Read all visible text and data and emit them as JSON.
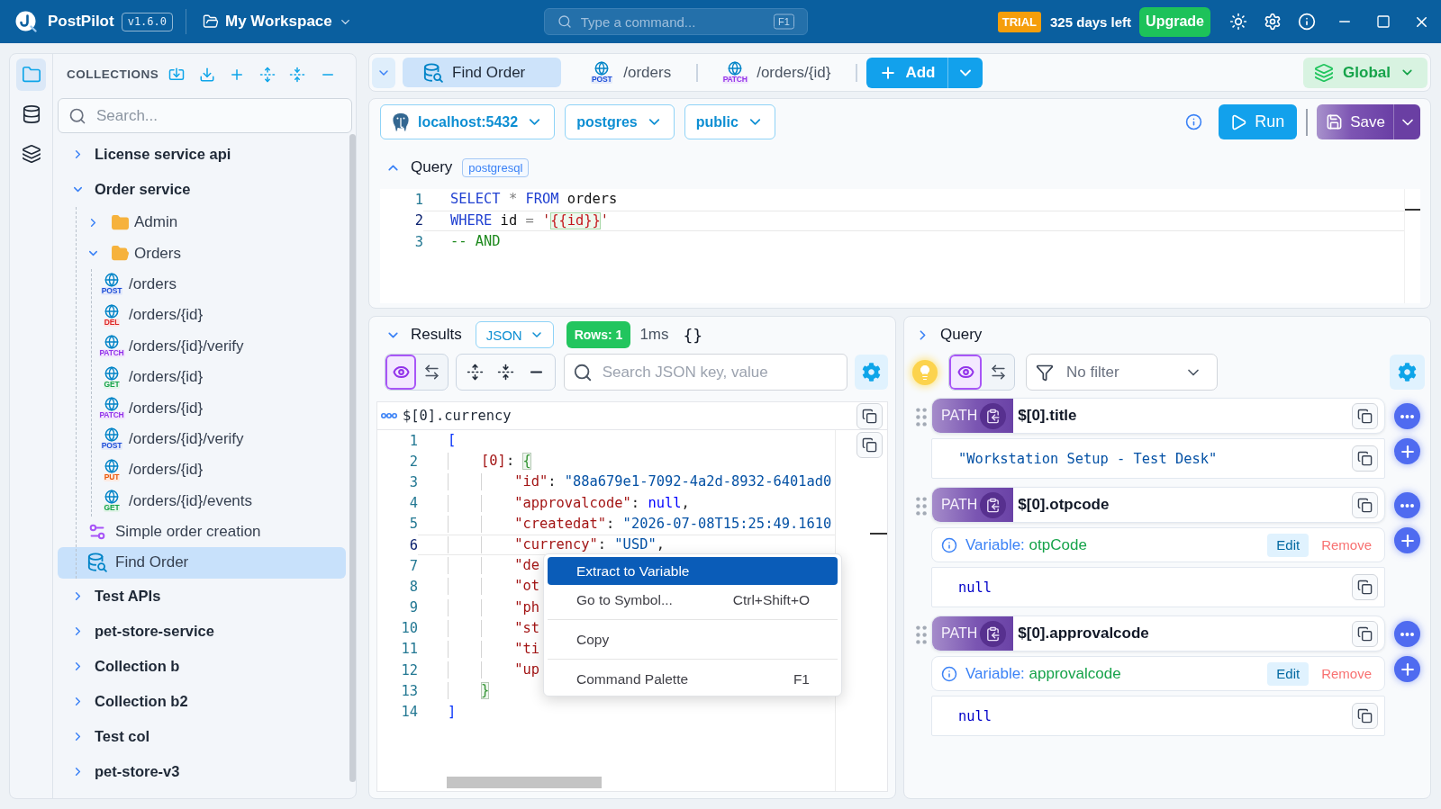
{
  "title_bar": {
    "app_name": "PostPilot",
    "version": "v1.6.0",
    "workspace": "My Workspace",
    "command": {
      "placeholder": "Type a command...",
      "shortcut": "F1"
    },
    "license": {
      "badge": "TRIAL",
      "remaining": "325 days left"
    },
    "upgrade": "Upgrade"
  },
  "activity_bar": [
    {
      "kind": "collections",
      "selected": true
    },
    {
      "kind": "databases",
      "selected": false
    },
    {
      "kind": "environments",
      "selected": false
    }
  ],
  "sidebar": {
    "title": "COLLECTIONS",
    "search": {
      "placeholder": "Search..."
    },
    "tree": [
      {
        "label": "License service api",
        "kind": "collection",
        "expanded": false,
        "selected": false
      },
      {
        "label": "Order service",
        "kind": "collection",
        "expanded": true,
        "selected": false,
        "children": [
          {
            "label": "Admin",
            "kind": "folder",
            "expanded": false,
            "selected": false
          },
          {
            "label": "Orders",
            "kind": "folder",
            "expanded": true,
            "selected": false,
            "children": [
              {
                "label": "/orders",
                "kind": "request",
                "method": "POST",
                "color": "#1d4ed8",
                "selected": false
              },
              {
                "label": "/orders/{id}",
                "kind": "request",
                "method": "DEL",
                "color": "#dc2626",
                "selected": false
              },
              {
                "label": "/orders/{id}/verify",
                "kind": "request",
                "method": "PATCH",
                "color": "#9333ea",
                "selected": false
              },
              {
                "label": "/orders/{id}",
                "kind": "request",
                "method": "GET",
                "color": "#16a34a",
                "selected": false
              },
              {
                "label": "/orders/{id}",
                "kind": "request",
                "method": "PATCH",
                "color": "#9333ea",
                "selected": false
              },
              {
                "label": "/orders/{id}/verify",
                "kind": "request",
                "method": "POST",
                "color": "#1d4ed8",
                "selected": false
              },
              {
                "label": "/orders/{id}",
                "kind": "request",
                "method": "PUT",
                "color": "#ea580c",
                "selected": false
              },
              {
                "label": "/orders/{id}/events",
                "kind": "request",
                "method": "GET",
                "color": "#16a34a",
                "selected": false
              }
            ]
          },
          {
            "label": "Simple order creation",
            "kind": "flow",
            "selected": false
          },
          {
            "label": "Find Order",
            "kind": "query",
            "selected": true
          }
        ]
      },
      {
        "label": "Test APIs",
        "kind": "collection",
        "expanded": false,
        "selected": false
      },
      {
        "label": "pet-store-service",
        "kind": "collection",
        "expanded": false,
        "selected": false
      },
      {
        "label": "Collection b",
        "kind": "collection",
        "expanded": false,
        "selected": false
      },
      {
        "label": "Collection b2",
        "kind": "collection",
        "expanded": false,
        "selected": false
      },
      {
        "label": "Test col",
        "kind": "collection",
        "expanded": false,
        "selected": false
      },
      {
        "label": "pet-store-v3",
        "kind": "collection",
        "expanded": false,
        "selected": false
      }
    ]
  },
  "tabs": {
    "items": [
      {
        "label": "Find Order",
        "kind": "query",
        "selected": true
      },
      {
        "label": "/orders",
        "kind": "request",
        "method": "POST",
        "color": "#1d4ed8",
        "selected": false
      },
      {
        "label": "/orders/{id}",
        "kind": "request",
        "method": "PATCH",
        "color": "#9333ea",
        "selected": false
      }
    ],
    "add": "Add",
    "environment": "Global"
  },
  "connection": {
    "selectors": [
      {
        "kind": "host",
        "label": "localhost:5432"
      },
      {
        "kind": "database",
        "label": "postgres"
      },
      {
        "kind": "schema",
        "label": "public"
      }
    ],
    "run": "Run",
    "save": "Save"
  },
  "query": {
    "title": "Query",
    "language": "postgresql",
    "lines": [
      {
        "number": "1",
        "active": false,
        "tokens": [
          {
            "text": "SELECT",
            "kind": "keyword"
          },
          {
            "text": " * ",
            "kind": "operator"
          },
          {
            "text": "FROM",
            "kind": "keyword"
          },
          {
            "text": " orders",
            "kind": "plain"
          }
        ]
      },
      {
        "number": "2",
        "active": true,
        "tokens": [
          {
            "text": "WHERE",
            "kind": "keyword"
          },
          {
            "text": " id ",
            "kind": "plain"
          },
          {
            "text": "= ",
            "kind": "operator"
          },
          {
            "text": "'",
            "kind": "quote"
          },
          {
            "text": "{{id}}",
            "kind": "variable"
          },
          {
            "text": "'",
            "kind": "quote"
          }
        ]
      },
      {
        "number": "3",
        "active": false,
        "tokens": [
          {
            "text": "-- AND",
            "kind": "comment"
          }
        ]
      }
    ]
  },
  "results": {
    "title": "Results",
    "format": "JSON",
    "rows": "Rows: 1",
    "duration": "1ms",
    "braces": "{}",
    "view_modes": [
      {
        "kind": "eye",
        "selected": true
      },
      {
        "kind": "swap",
        "selected": false
      }
    ],
    "search": {
      "placeholder": "Search JSON key, value"
    },
    "path": "$[0].currency",
    "lines": [
      {
        "number": "1",
        "active": false,
        "tokens": [
          {
            "text": "[",
            "kind": "open",
            "matched": false
          }
        ]
      },
      {
        "number": "2",
        "active": false,
        "tokens": [
          {
            "text": "[0]",
            "kind": "key"
          },
          {
            "text": ": ",
            "kind": "punct"
          },
          {
            "text": "{",
            "kind": "open",
            "matched": true
          }
        ]
      },
      {
        "number": "3",
        "active": false,
        "tokens": [
          {
            "text": "\"id\"",
            "kind": "key"
          },
          {
            "text": ": ",
            "kind": "punct"
          },
          {
            "text": "\"88a679e1-7092-4a2d-8932-6401ad0",
            "kind": "string"
          }
        ]
      },
      {
        "number": "4",
        "active": false,
        "tokens": [
          {
            "text": "\"approvalcode\"",
            "kind": "key"
          },
          {
            "text": ": ",
            "kind": "punct"
          },
          {
            "text": "null",
            "kind": "null"
          },
          {
            "text": ",",
            "kind": "punct"
          }
        ]
      },
      {
        "number": "5",
        "active": false,
        "tokens": [
          {
            "text": "\"createdat\"",
            "kind": "key"
          },
          {
            "text": ": ",
            "kind": "punct"
          },
          {
            "text": "\"2026-07-08T15:25:49.1610",
            "kind": "string"
          }
        ]
      },
      {
        "number": "6",
        "active": true,
        "tokens": [
          {
            "text": "\"currency\"",
            "kind": "key"
          },
          {
            "text": ": ",
            "kind": "punct"
          },
          {
            "text": "\"USD\"",
            "kind": "string"
          },
          {
            "text": ",",
            "kind": "punct"
          }
        ]
      },
      {
        "number": "7",
        "active": false,
        "tokens": [
          {
            "text": "\"de",
            "kind": "key"
          }
        ]
      },
      {
        "number": "8",
        "active": false,
        "tokens": [
          {
            "text": "\"ot",
            "kind": "key"
          }
        ]
      },
      {
        "number": "9",
        "active": false,
        "tokens": [
          {
            "text": "\"ph",
            "kind": "key"
          }
        ]
      },
      {
        "number": "10",
        "active": false,
        "tokens": [
          {
            "text": "\"st",
            "kind": "key"
          }
        ]
      },
      {
        "number": "11",
        "active": false,
        "tokens": [
          {
            "text": "\"ti",
            "kind": "key"
          }
        ]
      },
      {
        "number": "12",
        "active": false,
        "tokens": [
          {
            "text": "\"up",
            "kind": "key"
          }
        ]
      },
      {
        "number": "13",
        "active": false,
        "tokens": [
          {
            "text": "}",
            "kind": "close",
            "matched": true
          }
        ]
      },
      {
        "number": "14",
        "active": false,
        "tokens": [
          {
            "text": "]",
            "kind": "close",
            "matched": false
          }
        ]
      }
    ],
    "context_menu": {
      "groups": [
        {
          "items": [
            {
              "label": "Extract to Variable",
              "selected": true
            },
            {
              "label": "Go to Symbol...",
              "shortcut": "Ctrl+Shift+O",
              "selected": false
            }
          ]
        },
        {
          "items": [
            {
              "label": "Copy",
              "selected": false
            }
          ]
        },
        {
          "items": [
            {
              "label": "Command Palette",
              "shortcut": "F1",
              "selected": false
            }
          ]
        }
      ]
    }
  },
  "extractions": {
    "title": "Query",
    "view_modes": [
      {
        "kind": "eye",
        "selected": true
      },
      {
        "kind": "swap",
        "selected": false
      }
    ],
    "filter": "No filter",
    "items": [
      {
        "badge": "PATH",
        "path": "$[0].title",
        "value": "\"Workstation Setup - Test Desk\"",
        "kind": "string"
      },
      {
        "badge": "PATH",
        "path": "$[0].otpcode",
        "variable": {
          "label": "Variable:",
          "name": "otpCode",
          "edit": "Edit",
          "remove": "Remove"
        },
        "value": "null",
        "kind": "null"
      },
      {
        "badge": "PATH",
        "path": "$[0].approvalcode",
        "variable": {
          "label": "Variable:",
          "name": "approvalcode",
          "edit": "Edit",
          "remove": "Remove"
        },
        "value": "null",
        "kind": "null"
      }
    ]
  }
}
